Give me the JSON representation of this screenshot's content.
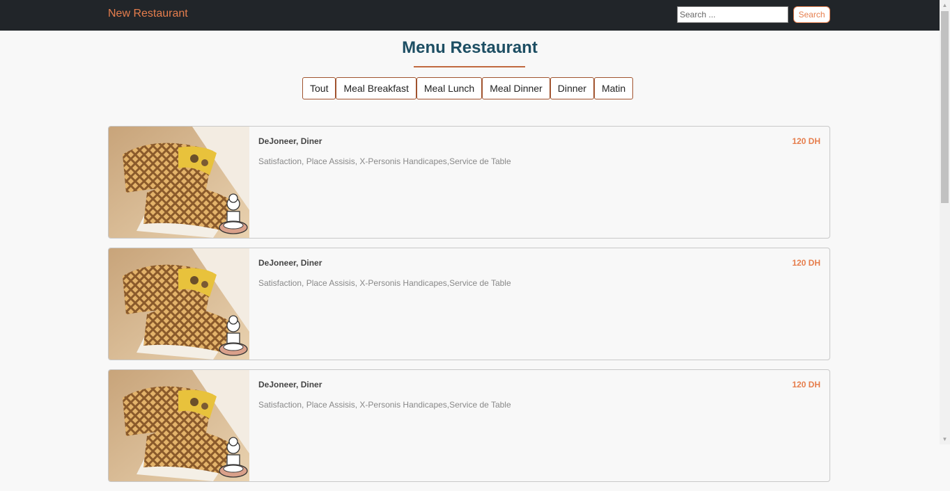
{
  "navbar": {
    "brand": "New Restaurant",
    "search_placeholder": "Search ...",
    "search_button": "Search"
  },
  "page": {
    "title": "Menu Restaurant"
  },
  "filters": [
    "Tout",
    "Meal Breakfast",
    "Meal Lunch",
    "Meal Dinner",
    "Dinner",
    "Matin"
  ],
  "menu_items": [
    {
      "name": "DeJoneer, Diner",
      "price": "120 DH",
      "description": "Satisfaction, Place Assisis, X-Personis Handicapes,Service de Table"
    },
    {
      "name": "DeJoneer, Diner",
      "price": "120 DH",
      "description": "Satisfaction, Place Assisis, X-Personis Handicapes,Service de Table"
    },
    {
      "name": "DeJoneer, Diner",
      "price": "120 DH",
      "description": "Satisfaction, Place Assisis, X-Personis Handicapes,Service de Table"
    }
  ],
  "colors": {
    "navbar_bg": "#212529",
    "accent": "#e67e4d",
    "title": "#1d4e63",
    "filter_border": "#a0522d"
  },
  "icons": {
    "card_image": "panini-sandwich-image",
    "chef_badge": "chef-icon"
  }
}
